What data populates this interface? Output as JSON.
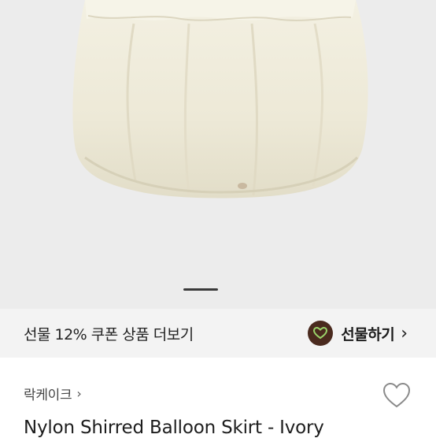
{
  "hero": {
    "image_alt": "Nylon Shirred Balloon Skirt - Ivory product photo"
  },
  "promo": {
    "text": "선물 12% 쿠폰 상품 더보기",
    "gift_label": "선물하기",
    "gift_icon": "gift-heart-icon",
    "chevron": "›"
  },
  "store": {
    "name": "락케이크",
    "chevron": "›"
  },
  "like": {
    "icon": "heart-outline-icon"
  },
  "product": {
    "title": "Nylon Shirred Balloon Skirt - Ivory"
  },
  "colors": {
    "hero_bg": "#ececec",
    "promo_bg": "#f3f3f3",
    "gift_icon_bg": "#4a2a1e",
    "gift_icon_fg": "#9bd46a"
  }
}
